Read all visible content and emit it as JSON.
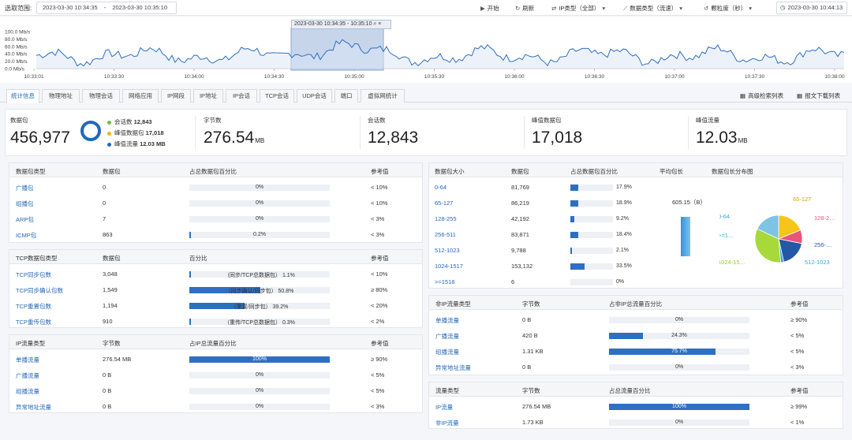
{
  "top": {
    "range_label": "选取范围:",
    "range_start": "2023-03-30 10:34:35",
    "range_sep": "-",
    "range_end": "2023-03-30 10:35:10",
    "start_btn": "开始",
    "refresh_btn": "刷新",
    "ip_type": "IP类型（全部）",
    "data_type": "数据类型（流速）",
    "granularity": "颗粒度（秒）",
    "current_time": "2023-03-30 10:44:13"
  },
  "traffic": {
    "y_ticks": [
      "100.0 Mb/s",
      "80.0 Mb/s",
      "60.0 Mb/s",
      "40.0 Mb/s",
      "20.0 Mb/s",
      "0.0 Mb/s"
    ],
    "x_ticks": [
      "10:33:01",
      "10:33:30",
      "10:34:00",
      "10:34:30",
      "10:35:00",
      "10:35:30",
      "10:36:00",
      "10:36:30",
      "10:37:00",
      "10:37:30",
      "10:38:00"
    ],
    "selection_label": "2023-03-30 10:34:35 - 10:35:10",
    "selection_search": "⌕",
    "selection_close": "×",
    "line_color": "#2f6fc2"
  },
  "tabs": [
    "统计信息",
    "物理地址",
    "物理会话",
    "网络应用",
    "IP网段",
    "IP地址",
    "IP会话",
    "TCP会话",
    "UDP会话",
    "端口",
    "虚拟网统计"
  ],
  "tab_actions": {
    "advanced": "高级检索列表",
    "download": "报文下载列表"
  },
  "summary": {
    "packets_label": "数据包",
    "packets_value": "456,977",
    "legend": [
      {
        "label": "会话数",
        "value": "12,843",
        "color": "#6cc04a"
      },
      {
        "label": "峰值数据包",
        "value": "17,018",
        "color": "#f5b400"
      },
      {
        "label": "峰值流量",
        "value": "12.03 MB",
        "color": "#2368b8"
      }
    ],
    "bytes_label": "字节数",
    "bytes_value": "276.54",
    "bytes_unit": "MB",
    "sessions_label": "会话数",
    "sessions_value": "12,843",
    "peak_pkt_label": "峰值数据包",
    "peak_pkt_value": "17,018",
    "peak_flow_label": "峰值流量",
    "peak_flow_value": "12.03",
    "peak_flow_unit": "MB"
  },
  "pkt_type": {
    "headers": [
      "数据包类型",
      "数据包",
      "占总数据包百分比",
      "参考值"
    ],
    "rows": [
      {
        "name": "广播包",
        "value": "0",
        "pct": "0%",
        "frac": 0,
        "ref": "< 10%"
      },
      {
        "name": "组播包",
        "value": "0",
        "pct": "0%",
        "frac": 0,
        "ref": "< 10%"
      },
      {
        "name": "ARP包",
        "value": "7",
        "pct": "0%",
        "frac": 0,
        "ref": "< 3%"
      },
      {
        "name": "ICMP包",
        "value": "863",
        "pct": "0.2%",
        "frac": 0.002,
        "ref": "< 3%"
      }
    ]
  },
  "tcp_type": {
    "headers": [
      "TCP数据包类型",
      "数据包",
      "百分比",
      "参考值"
    ],
    "rows": [
      {
        "name": "TCP同步包数",
        "value": "3,048",
        "pct": "（同步/TCP总数据包） 1.1%",
        "frac": 0.011,
        "ref": "< 10%"
      },
      {
        "name": "TCP同步确认包数",
        "value": "1,549",
        "pct": "（同步确认/同步包） 50.8%",
        "frac": 0.508,
        "ref": "≥ 80%"
      },
      {
        "name": "TCP重置包数",
        "value": "1,194",
        "pct": "（重置/同步包） 39.2%",
        "frac": 0.392,
        "ref": "< 20%"
      },
      {
        "name": "TCP重传包数",
        "value": "910",
        "pct": "（重传/TCP总数据包） 0.3%",
        "frac": 0.003,
        "ref": "< 2%"
      }
    ]
  },
  "ip_flow": {
    "headers": [
      "IP流量类型",
      "字节数",
      "占IP总流量百分比",
      "参考值"
    ],
    "rows": [
      {
        "name": "单播流量",
        "value": "276.54 MB",
        "pct": "100%",
        "frac": 1,
        "ref": "≥ 90%"
      },
      {
        "name": "广播流量",
        "value": "0 B",
        "pct": "0%",
        "frac": 0,
        "ref": "< 5%"
      },
      {
        "name": "组播流量",
        "value": "0 B",
        "pct": "0%",
        "frac": 0,
        "ref": "< 5%"
      },
      {
        "name": "异常地址流量",
        "value": "0 B",
        "pct": "0%",
        "frac": 0,
        "ref": "< 3%"
      }
    ]
  },
  "pkt_size": {
    "headers": [
      "数据包大小",
      "数据包",
      "占总数据包百分比",
      "平均包长",
      "数据包长分布图"
    ],
    "rows": [
      {
        "name": "0-64",
        "value": "81,769",
        "pct": "17.9%",
        "frac": 0.179
      },
      {
        "name": "65-127",
        "value": "86,219",
        "pct": "18.9%",
        "frac": 0.189
      },
      {
        "name": "128-255",
        "value": "42,192",
        "pct": "9.2%",
        "frac": 0.092
      },
      {
        "name": "256-511",
        "value": "83,871",
        "pct": "18.4%",
        "frac": 0.184
      },
      {
        "name": "512-1023",
        "value": "9,788",
        "pct": "2.1%",
        "frac": 0.021
      },
      {
        "name": "1024-1517",
        "value": "153,132",
        "pct": "33.5%",
        "frac": 0.335
      },
      {
        "name": ">=1518",
        "value": "6",
        "pct": "0%",
        "frac": 0
      }
    ],
    "avg_len": "605.15（B）",
    "pie": [
      {
        "label": "65-127",
        "frac": 0.189,
        "color": "#f5c518"
      },
      {
        "label": "128-2…",
        "frac": 0.092,
        "color": "#e8557a"
      },
      {
        "label": "256-…",
        "frac": 0.184,
        "color": "#2457a6"
      },
      {
        "label": "512-1023",
        "frac": 0.021,
        "color": "#3aa5d8"
      },
      {
        "label": "1024-15…",
        "frac": 0.335,
        "color": "#a8d93a"
      },
      {
        "label": ">=1…",
        "frac": 0.0001,
        "color": "#8fd0ef"
      },
      {
        "label": "0-64",
        "frac": 0.179,
        "color": "#7cc3e6"
      }
    ]
  },
  "non_ip": {
    "headers": [
      "非IP流量类型",
      "字节数",
      "占非IP总流量百分比",
      "参考值"
    ],
    "rows": [
      {
        "name": "单播流量",
        "value": "0 B",
        "pct": "0%",
        "frac": 0,
        "ref": "≥ 90%"
      },
      {
        "name": "广播流量",
        "value": "420 B",
        "pct": "24.3%",
        "frac": 0.243,
        "ref": "< 5%"
      },
      {
        "name": "组播流量",
        "value": "1.31 KB",
        "pct": "75.7%",
        "frac": 0.757,
        "ref": "< 5%"
      },
      {
        "name": "异常地址流量",
        "value": "0 B",
        "pct": "0%",
        "frac": 0,
        "ref": "< 3%"
      }
    ]
  },
  "flow_type": {
    "headers": [
      "流量类型",
      "字节数",
      "占总流量百分比",
      "参考值"
    ],
    "rows": [
      {
        "name": "IP流量",
        "value": "276.54 MB",
        "pct": "100%",
        "frac": 1,
        "ref": "≥ 99%"
      },
      {
        "name": "非IP流量",
        "value": "1.73 KB",
        "pct": "0%",
        "frac": 0,
        "ref": "< 1%"
      }
    ]
  }
}
